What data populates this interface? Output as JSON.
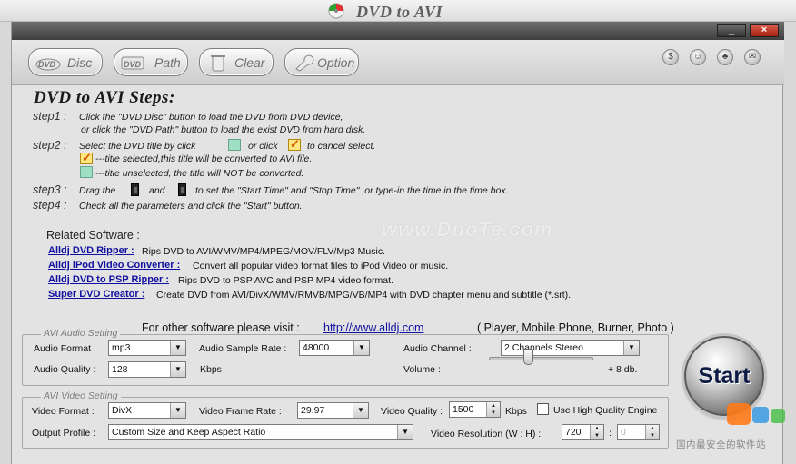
{
  "window": {
    "title": "DVD to AVI",
    "minimize_label": "_",
    "close_label": "×"
  },
  "toolbar": {
    "disc_label": "Disc",
    "path_label": "Path",
    "clear_label": "Clear",
    "option_label": "Option",
    "right_icons": [
      "$",
      "☺",
      "♣",
      "✉"
    ]
  },
  "steps": {
    "title": "DVD to AVI Steps:",
    "step1_label": "step1 :",
    "step1_line1": "Click the \"DVD Disc\" button to load the DVD from DVD device,",
    "step1_line2": "or click the \"DVD Path\" button to load the exist DVD from hard disk.",
    "step2_label": "step2 :",
    "step2_a": "Select the DVD title by click",
    "step2_b": "or click",
    "step2_c": "to cancel select.",
    "step2_selected": "---title selected,this title will be converted to AVI file.",
    "step2_unselected": "---title unselected, the title will NOT be converted.",
    "step3_label": "step3 :",
    "step3_a": "Drag the",
    "step3_b": "and",
    "step3_c": "to set the \"Start Time\" and \"Stop Time\" ,or type-in the time in the time box.",
    "step4_label": "step4 :",
    "step4_text": "Check all the parameters and click the \"Start\" button."
  },
  "related": {
    "watermark": "www.DuoTe.com",
    "title": "Related Software :",
    "items": [
      {
        "link": "Alldj DVD Ripper :",
        "desc": "Rips DVD to AVI/WMV/MP4/MPEG/MOV/FLV/Mp3 Music."
      },
      {
        "link": "Alldj iPod Video Converter :",
        "desc": "Convert all popular video format files to iPod Video or music."
      },
      {
        "link": "Alldj DVD to PSP Ripper :",
        "desc": "Rips DVD to PSP AVC and PSP MP4 video format."
      },
      {
        "link": "Super DVD Creator :",
        "desc": "Create DVD from AVI/DivX/WMV/RMVB/MPG/VB/MP4 with DVD chapter menu and subtitle (*.srt)."
      }
    ],
    "other_text": "For other software please visit :",
    "site": "http://www.alldj.com",
    "platforms": "( Player, Mobile Phone, Burner, Photo )"
  },
  "audio": {
    "legend": "AVI Audio Setting",
    "format_label": "Audio Format :",
    "format_value": "mp3",
    "rate_label": "Audio Sample Rate :",
    "rate_value": "48000",
    "channel_label": "Audio Channel :",
    "channel_value": "2 Channels Stereo",
    "quality_label": "Audio Quality :",
    "quality_value": "128",
    "quality_unit": "Kbps",
    "volume_label": "Volume :",
    "volume_value": "+ 8 db."
  },
  "video": {
    "legend": "AVI Video Setting",
    "format_label": "Video Format :",
    "format_value": "DivX",
    "framerate_label": "Video Frame Rate :",
    "framerate_value": "29.97",
    "quality_label": "Video Quality :",
    "quality_value": "1500",
    "quality_unit": "Kbps",
    "hq_label": "Use High Quality Engine",
    "profile_label": "Output Profile :",
    "profile_value": "Custom Size and Keep Aspect Ratio",
    "resolution_label": "Video Resolution (W : H) :",
    "res_w": "720",
    "res_sep": ":",
    "res_h": "0"
  },
  "start": {
    "label": "Start"
  },
  "corner": {
    "text": "国内最安全的软件站"
  }
}
